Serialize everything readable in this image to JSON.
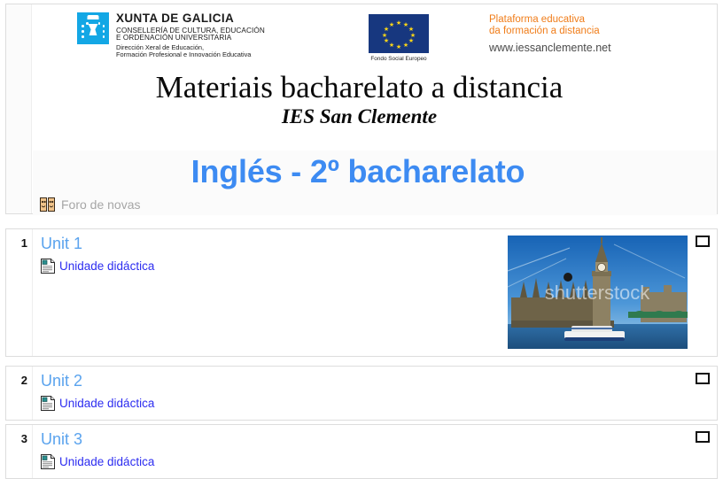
{
  "header": {
    "xunta": {
      "logo_icon": "galicia-coat-of-arms-icon",
      "title": "XUNTA DE GALICIA",
      "line2": "CONSELLERÍA DE CULTURA, EDUCACIÓN",
      "line3": "E ORDENACIÓN UNIVERSITARIA",
      "line4": "Dirección Xeral de Educación,",
      "line5": "Formación Profesional e Innovación Educativa"
    },
    "eu": {
      "flag_icon": "european-union-flag-icon",
      "caption": "Fondo Social Europeo",
      "flag_color": "#17377f",
      "star_color": "#ffd617"
    },
    "platform": {
      "line1": "Plataforma educativa",
      "line2": "da formación a distancia",
      "url": "www.iessanclemente.net",
      "accent_color": "#f07d1a"
    },
    "banner_title": "Materiais bacharelato a distancia",
    "banner_subtitle": "IES San Clemente",
    "course_headline": "Inglés - 2º bacharelato",
    "course_headline_color": "#3d8bf2",
    "forum": {
      "icon": "forum-icon",
      "label": "Foro de novas"
    }
  },
  "sections": [
    {
      "number": "1",
      "title": "Unit 1",
      "resource_icon": "document-icon",
      "resource_label": "Unidade didáctica",
      "checkbox_name": "section-select-checkbox",
      "image": {
        "name": "big-ben-westminster-photo",
        "watermark": "shutterstock"
      }
    },
    {
      "number": "2",
      "title": "Unit 2",
      "resource_icon": "document-icon",
      "resource_label": "Unidade didáctica",
      "checkbox_name": "section-select-checkbox"
    },
    {
      "number": "3",
      "title": "Unit 3",
      "resource_icon": "document-icon",
      "resource_label": "Unidade didáctica",
      "checkbox_name": "section-select-checkbox"
    }
  ]
}
